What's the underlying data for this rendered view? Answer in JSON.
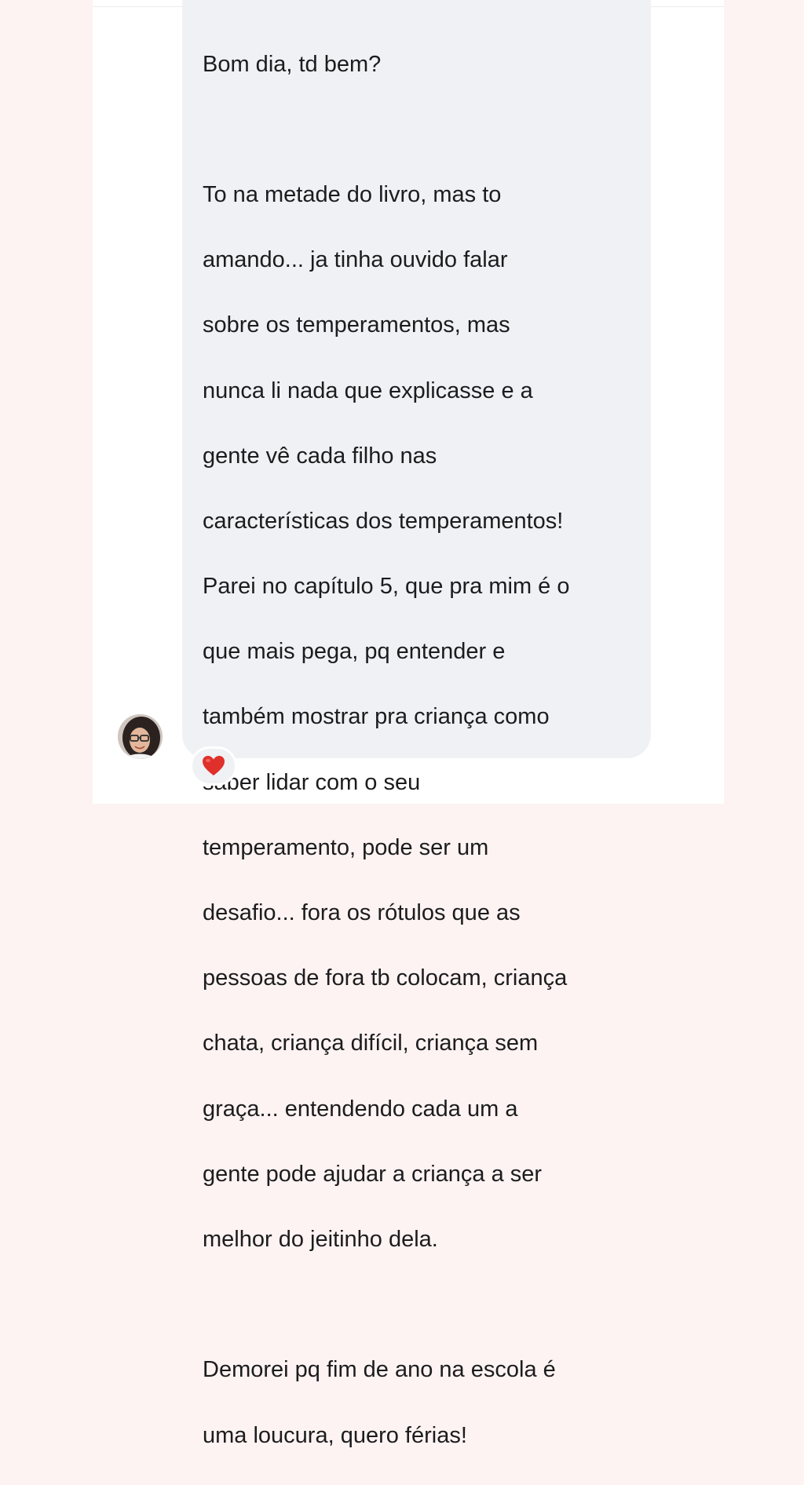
{
  "message": {
    "lines": [
      "Bom dia, td bem?",
      "",
      "To na metade do livro, mas to",
      "amando... ja tinha ouvido falar",
      "sobre os temperamentos, mas",
      "nunca li nada que explicasse e a",
      "gente vê cada filho nas",
      "características dos temperamentos!",
      "Parei no capítulo 5, que pra mim é o",
      "que mais pega, pq entender e",
      "também mostrar pra criança como",
      "saber lidar com o seu",
      "temperamento, pode ser um",
      "desafio... fora os rótulos que as",
      "pessoas de fora tb colocam, criança",
      "chata, criança difícil, criança sem",
      "graça... entendendo cada um a",
      "gente pode ajudar a criança a ser",
      "melhor do jeitinho dela.",
      "",
      "Demorei pq fim de ano na escola é",
      "uma loucura, quero férias!"
    ]
  },
  "reaction": {
    "icon": "red-heart-icon",
    "color": "#e0302c"
  },
  "avatar": {
    "icon": "user-avatar"
  },
  "colors": {
    "bubble": "#f0f1f4",
    "text": "#1c1c1e",
    "page_background": "#fdf3f2"
  }
}
